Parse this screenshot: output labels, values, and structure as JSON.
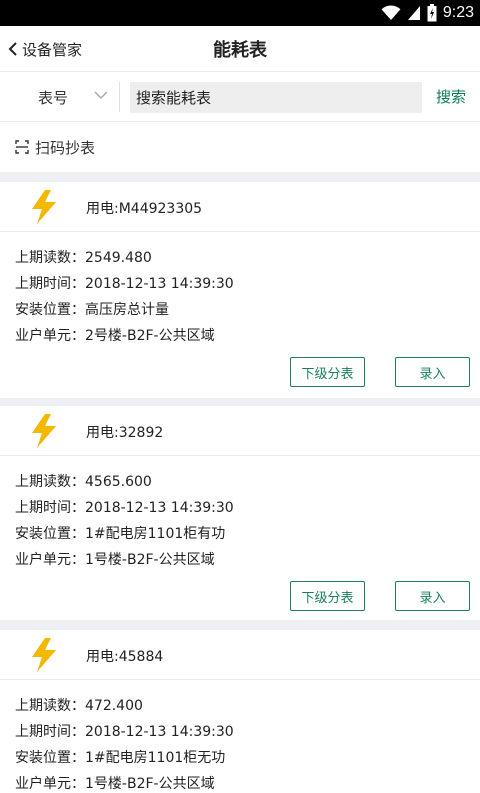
{
  "status_bar": {
    "time": "9:23",
    "icons": [
      "wifi-icon",
      "signal-icon",
      "battery-icon"
    ]
  },
  "nav": {
    "back_label": "设备管家",
    "title": "能耗表"
  },
  "search": {
    "type_label": "表号",
    "input_value": "搜索能耗表",
    "button_label": "搜索"
  },
  "scan": {
    "label": "扫码抄表"
  },
  "colors": {
    "accent": "#1b7f5e",
    "bolt": "#f5b800",
    "divider_bg": "#eef0f4"
  },
  "cards": [
    {
      "title": "用电:M44923305",
      "rows": [
        {
          "key": "上期读数：",
          "value": "2549.480"
        },
        {
          "key": "上期时间：",
          "value": "2018-12-13 14:39:30"
        },
        {
          "key": "安装位置：",
          "value": "高压房总计量"
        },
        {
          "key": "业户单元：",
          "value": "2号楼-B2F-公共区域"
        }
      ],
      "btn_sub": "下级分表",
      "btn_enter": "录入"
    },
    {
      "title": "用电:32892",
      "rows": [
        {
          "key": "上期读数：",
          "value": "4565.600"
        },
        {
          "key": "上期时间：",
          "value": "2018-12-13 14:39:30"
        },
        {
          "key": "安装位置：",
          "value": "1#配电房1101柜有功"
        },
        {
          "key": "业户单元：",
          "value": "1号楼-B2F-公共区域"
        }
      ],
      "btn_sub": "下级分表",
      "btn_enter": "录入"
    },
    {
      "title": "用电:45884",
      "rows": [
        {
          "key": "上期读数：",
          "value": "472.400"
        },
        {
          "key": "上期时间：",
          "value": "2018-12-13 14:39:30"
        },
        {
          "key": "安装位置：",
          "value": "1#配电房1101柜无功"
        },
        {
          "key": "业户单元：",
          "value": "1号楼-B2F-公共区域"
        }
      ]
    }
  ]
}
